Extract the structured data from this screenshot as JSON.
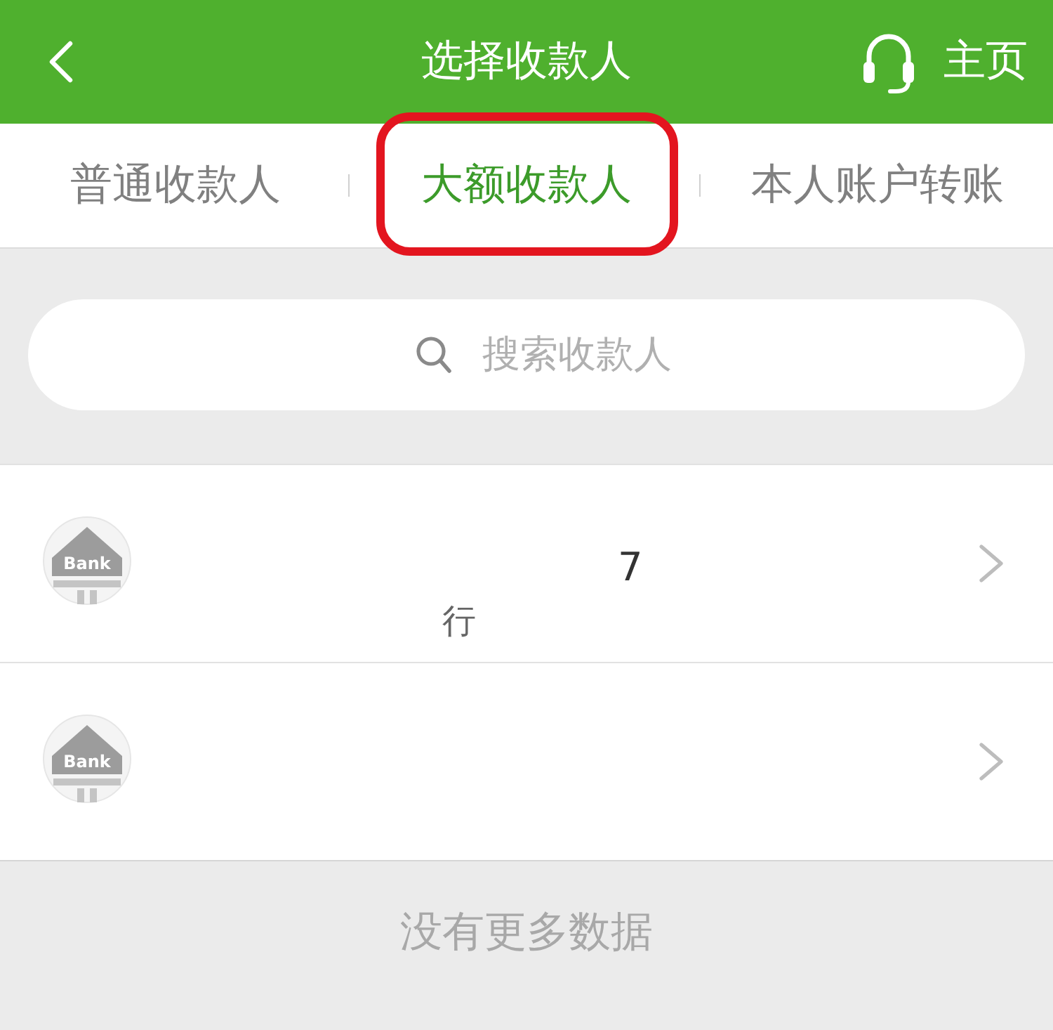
{
  "header": {
    "title": "选择收款人",
    "home_label": "主页"
  },
  "tabs": [
    {
      "label": "普通收款人",
      "selected": false,
      "highlighted": false
    },
    {
      "label": "大额收款人",
      "selected": true,
      "highlighted": true
    },
    {
      "label": "本人账户转账",
      "selected": false,
      "highlighted": false
    }
  ],
  "search": {
    "placeholder": "搜索收款人"
  },
  "payees": [
    {
      "logo_text": "Bank",
      "account": "7",
      "bank": "行"
    },
    {
      "logo_text": "Bank"
    }
  ],
  "footer": {
    "message": "没有更多数据"
  }
}
